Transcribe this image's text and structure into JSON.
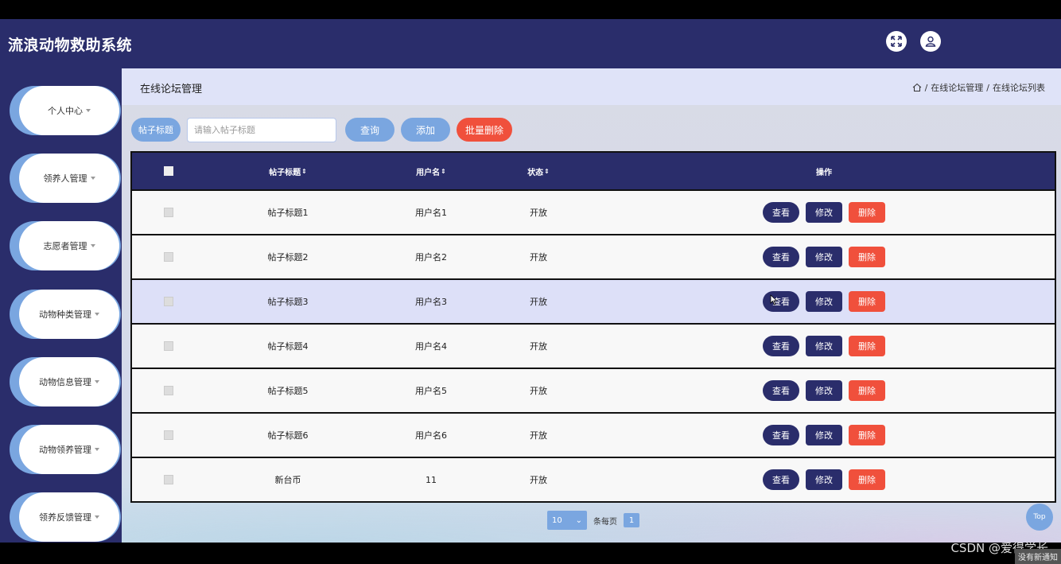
{
  "app": {
    "title": "流浪动物救助系统"
  },
  "header": {
    "fullscreen_icon": "fullscreen-icon",
    "user_icon": "user-icon"
  },
  "sidebar": {
    "items": [
      {
        "label": "个人中心"
      },
      {
        "label": "领养人管理"
      },
      {
        "label": "志愿者管理"
      },
      {
        "label": "动物种类管理"
      },
      {
        "label": "动物信息管理"
      },
      {
        "label": "动物领养管理"
      },
      {
        "label": "领养反馈管理"
      }
    ]
  },
  "page": {
    "title": "在线论坛管理",
    "breadcrumb": {
      "sep": "/",
      "level1": "在线论坛管理",
      "level2": "在线论坛列表"
    }
  },
  "search": {
    "label": "帖子标题",
    "placeholder": "请输入帖子标题",
    "query_label": "查询",
    "add_label": "添加",
    "batch_delete_label": "批量删除"
  },
  "table": {
    "headers": {
      "title": "帖子标题",
      "user": "用户名",
      "status": "状态",
      "ops": "操作",
      "sort_mark": "⇕"
    },
    "rows": [
      {
        "title": "帖子标题1",
        "user": "用户名1",
        "status": "开放"
      },
      {
        "title": "帖子标题2",
        "user": "用户名2",
        "status": "开放"
      },
      {
        "title": "帖子标题3",
        "user": "用户名3",
        "status": "开放"
      },
      {
        "title": "帖子标题4",
        "user": "用户名4",
        "status": "开放"
      },
      {
        "title": "帖子标题5",
        "user": "用户名5",
        "status": "开放"
      },
      {
        "title": "帖子标题6",
        "user": "用户名6",
        "status": "开放"
      },
      {
        "title": "新台币",
        "user": "11",
        "status": "开放"
      }
    ],
    "op_view": "查看",
    "op_edit": "修改",
    "op_delete": "删除"
  },
  "pager": {
    "page_size": "10",
    "per_page_label": "条每页",
    "current_page": "1"
  },
  "top_button": "Top",
  "watermark": "CSDN @爱得学长",
  "notice": "没有新通知",
  "colors": {
    "navy": "#2a2d6b",
    "accent": "#7aa6e0",
    "danger": "#f0503c"
  }
}
